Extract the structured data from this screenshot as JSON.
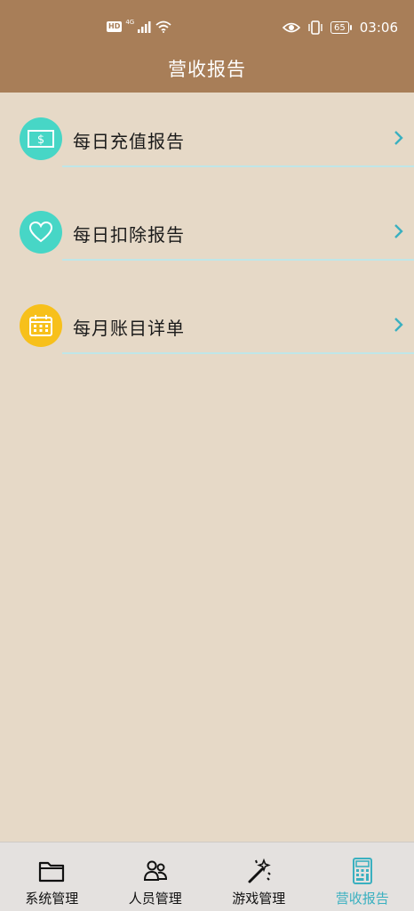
{
  "status_bar": {
    "hd": "HD",
    "network": "4G",
    "battery": "65",
    "time": "03:06"
  },
  "header": {
    "title": "营收报告"
  },
  "menu": [
    {
      "label": "每日充值报告",
      "icon": "money-bill-icon",
      "color": "#47d6c6"
    },
    {
      "label": "每日扣除报告",
      "icon": "heart-icon",
      "color": "#47d6c6"
    },
    {
      "label": "每月账目详单",
      "icon": "calendar-icon",
      "color": "#f7c01b"
    }
  ],
  "tabs": [
    {
      "label": "系统管理",
      "icon": "folder-icon"
    },
    {
      "label": "人员管理",
      "icon": "people-icon"
    },
    {
      "label": "游戏管理",
      "icon": "magic-wand-icon"
    },
    {
      "label": "营收报告",
      "icon": "calculator-icon",
      "active": true
    }
  ],
  "colors": {
    "header_bg": "#a87e58",
    "page_bg": "#e6d9c7",
    "accent": "#3ab0c0"
  }
}
